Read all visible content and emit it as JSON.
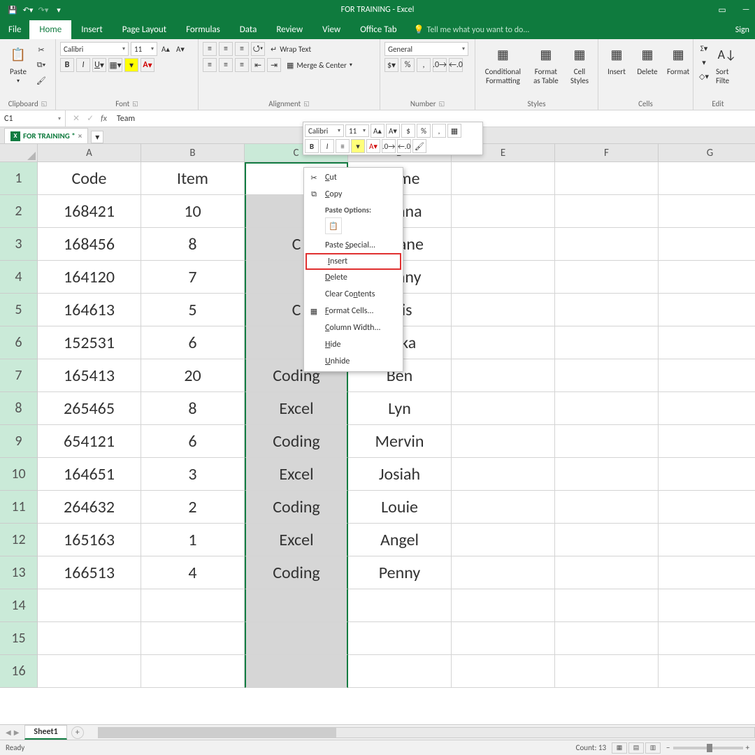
{
  "window": {
    "title": "FOR TRAINING - Excel",
    "signin": "Sign"
  },
  "menubar": {
    "file": "File",
    "tabs": [
      "Home",
      "Insert",
      "Page Layout",
      "Formulas",
      "Data",
      "Review",
      "View",
      "Office Tab"
    ],
    "active": "Home",
    "tellme": "Tell me what you want to do..."
  },
  "ribbon": {
    "clipboard": {
      "paste": "Paste",
      "label": "Clipboard"
    },
    "font": {
      "name": "Calibri",
      "size": "11",
      "label": "Font"
    },
    "alignment": {
      "wrap": "Wrap Text",
      "merge": "Merge & Center",
      "label": "Alignment"
    },
    "number": {
      "format": "General",
      "label": "Number"
    },
    "styles": {
      "cond": "Conditional Formatting",
      "table": "Format as Table",
      "cell": "Cell Styles",
      "label": "Styles"
    },
    "cells": {
      "insert": "Insert",
      "delete": "Delete",
      "format": "Format",
      "label": "Cells"
    },
    "editing": {
      "sort": "Sort Filte",
      "label": "Edit"
    }
  },
  "formula_bar": {
    "name_box": "C1",
    "value": "Team"
  },
  "workbook_tab": {
    "name": "FOR TRAINING *"
  },
  "columns": [
    "A",
    "B",
    "C",
    "D",
    "E",
    "F",
    "G"
  ],
  "rows": [
    1,
    2,
    3,
    4,
    5,
    6,
    7,
    8,
    9,
    10,
    11,
    12,
    13,
    14,
    15,
    16
  ],
  "selected_column": "C",
  "sheet": {
    "headers": [
      "Code",
      "Item",
      "",
      "Name"
    ],
    "data": [
      [
        "168421",
        "10",
        "",
        "Donna"
      ],
      [
        "168456",
        "8",
        "C",
        "ernane"
      ],
      [
        "164120",
        "7",
        "",
        "Danny"
      ],
      [
        "164613",
        "5",
        "C",
        "Cris"
      ],
      [
        "152531",
        "6",
        "",
        "Erika"
      ],
      [
        "165413",
        "20",
        "Coding",
        "Ben"
      ],
      [
        "265465",
        "8",
        "Excel",
        "Lyn"
      ],
      [
        "654121",
        "6",
        "Coding",
        "Mervin"
      ],
      [
        "164651",
        "3",
        "Excel",
        "Josiah"
      ],
      [
        "264632",
        "2",
        "Coding",
        "Louie"
      ],
      [
        "165163",
        "1",
        "Excel",
        "Angel"
      ],
      [
        "166513",
        "4",
        "Coding",
        "Penny"
      ]
    ]
  },
  "mini_toolbar": {
    "font": "Calibri",
    "size": "11"
  },
  "context_menu": {
    "cut": "Cut",
    "copy": "Copy",
    "paste_options": "Paste Options:",
    "paste_special": "Paste Special...",
    "insert": "Insert",
    "delete": "Delete",
    "clear": "Clear Contents",
    "format_cells": "Format Cells...",
    "col_width": "Column Width...",
    "hide": "Hide",
    "unhide": "Unhide"
  },
  "sheet_tab": "Sheet1",
  "statusbar": {
    "ready": "Ready",
    "count": "Count: 13",
    "zoom": "+"
  }
}
